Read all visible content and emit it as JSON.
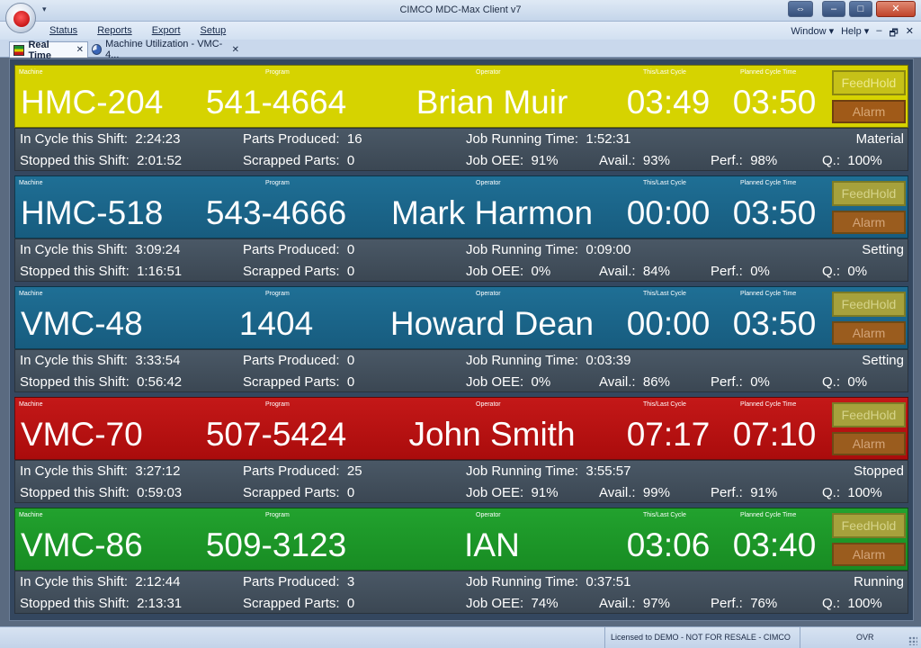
{
  "window": {
    "title": "CIMCO MDC-Max Client v7",
    "min_label": "–",
    "max_label": "□",
    "close_label": "✕",
    "restore_label": "⇔"
  },
  "menu": {
    "items": [
      "Status",
      "Reports",
      "Export",
      "Setup"
    ],
    "window_label": "Window",
    "help_label": "Help",
    "mdi_min": "–",
    "mdi_restore": "🗗",
    "mdi_close": "✕"
  },
  "tabs": [
    {
      "label": "Real Time",
      "close": "✕"
    },
    {
      "label": "Machine Utilization  -  VMC-4...",
      "close": "✕"
    }
  ],
  "labels": {
    "machine": "Machine",
    "program": "Program",
    "operator": "Operator",
    "cycle": "This/Last Cycle",
    "planned": "Planned Cycle Time",
    "feedhold": "FeedHold",
    "alarm": "Alarm",
    "in_cycle": "In Cycle this Shift:",
    "stopped": "Stopped this Shift:",
    "parts_produced": "Parts Produced:",
    "scrapped": "Scrapped Parts:",
    "job_running": "Job Running Time:",
    "job_oee": "Job OEE:",
    "avail": "Avail.:",
    "perf": "Perf.:",
    "quality": "Q.:"
  },
  "machines": [
    {
      "machine": "HMC-204",
      "program": "541-4664",
      "operator": "Brian Muir",
      "cycle": "03:49",
      "planned": "03:50",
      "color": "#d6d300",
      "in_cycle": "2:24:23",
      "stopped": "2:01:52",
      "parts_produced": "16",
      "scrapped": "0",
      "job_running": "1:52:31",
      "status": "Material",
      "job_oee": "91%",
      "avail": "93%",
      "perf": "98%",
      "quality": "100%"
    },
    {
      "machine": "HMC-518",
      "program": "543-4666",
      "operator": "Mark Harmon",
      "cycle": "00:00",
      "planned": "03:50",
      "color": "#1f6f95",
      "in_cycle": "3:09:24",
      "stopped": "1:16:51",
      "parts_produced": "0",
      "scrapped": "0",
      "job_running": "0:09:00",
      "status": "Setting",
      "job_oee": "0%",
      "avail": "84%",
      "perf": "0%",
      "quality": "0%"
    },
    {
      "machine": "VMC-48",
      "program": "1404",
      "operator": "Howard Dean",
      "cycle": "00:00",
      "planned": "03:50",
      "color": "#1f6f95",
      "in_cycle": "3:33:54",
      "stopped": "0:56:42",
      "parts_produced": "0",
      "scrapped": "0",
      "job_running": "0:03:39",
      "status": "Setting",
      "job_oee": "0%",
      "avail": "86%",
      "perf": "0%",
      "quality": "0%"
    },
    {
      "machine": "VMC-70",
      "program": "507-5424",
      "operator": "John Smith",
      "cycle": "07:17",
      "planned": "07:10",
      "color": "#c41818",
      "in_cycle": "3:27:12",
      "stopped": "0:59:03",
      "parts_produced": "25",
      "scrapped": "0",
      "job_running": "3:55:57",
      "status": "Stopped",
      "job_oee": "91%",
      "avail": "99%",
      "perf": "91%",
      "quality": "100%"
    },
    {
      "machine": "VMC-86",
      "program": "509-3123",
      "operator": "IAN",
      "cycle": "03:06",
      "planned": "03:40",
      "color": "#22a22e",
      "in_cycle": "2:12:44",
      "stopped": "2:13:31",
      "parts_produced": "3",
      "scrapped": "0",
      "job_running": "0:37:51",
      "status": "Running",
      "job_oee": "74%",
      "avail": "97%",
      "perf": "76%",
      "quality": "100%"
    }
  ],
  "statusbar": {
    "license": "Licensed to DEMO - NOT FOR RESALE - CIMCO A/S",
    "ovr": "OVR"
  }
}
